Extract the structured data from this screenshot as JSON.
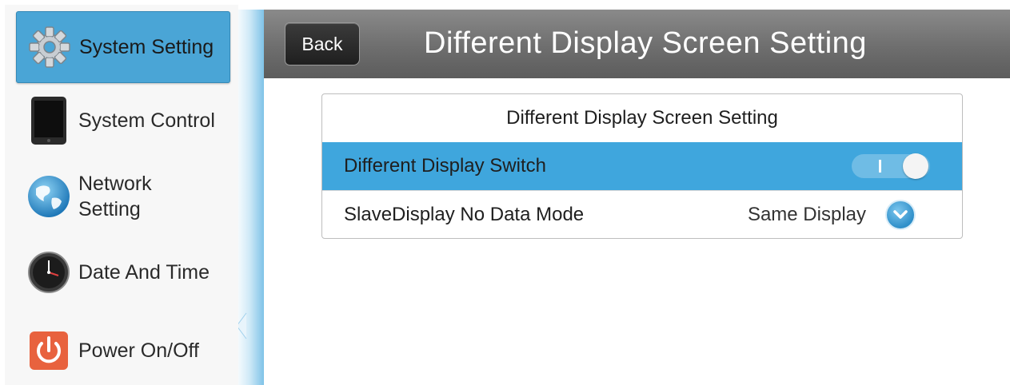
{
  "sidebar": {
    "items": [
      {
        "label": "System Setting",
        "icon": "gear-icon",
        "active": true
      },
      {
        "label": "System Control",
        "icon": "tablet-icon",
        "active": false
      },
      {
        "label": "Network\nSetting",
        "label_line1": "Network",
        "label_line2": "Setting",
        "icon": "globe-icon",
        "active": false
      },
      {
        "label": "Date And Time",
        "icon": "clock-icon",
        "active": false
      },
      {
        "label": "Power On/Off",
        "icon": "power-icon",
        "active": false
      }
    ]
  },
  "header": {
    "back_label": "Back",
    "title": "Different Display Screen Setting"
  },
  "panel": {
    "title": "Different Display Screen Setting",
    "rows": [
      {
        "label": "Different Display Switch",
        "control": "toggle",
        "toggle_state": "on",
        "highlighted": true
      },
      {
        "label": "SlaveDisplay No Data Mode",
        "value": "Same Display",
        "control": "dropdown",
        "highlighted": false
      }
    ]
  },
  "colors": {
    "accent": "#3fa6dd",
    "active_sidebar": "#4aa5d6",
    "header_bg": "#6e6e6e",
    "power_icon": "#e8623e"
  }
}
